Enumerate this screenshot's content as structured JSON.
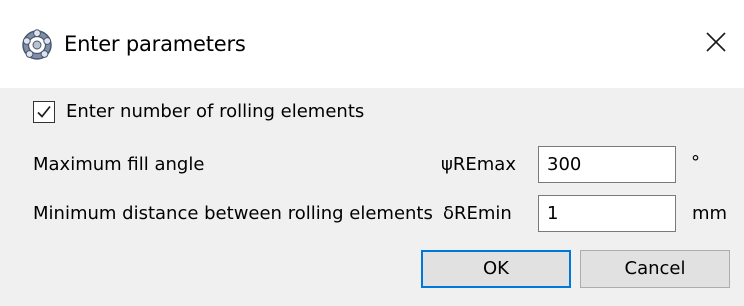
{
  "window": {
    "title": "Enter parameters",
    "app_icon": "rolling-bearing-icon",
    "close_icon": "close-icon"
  },
  "checkbox": {
    "label": "Enter number of rolling elements",
    "checked": true
  },
  "rows": [
    {
      "label": "Maximum fill angle",
      "symbol": "ψREmax",
      "value": "300",
      "unit": "°"
    },
    {
      "label": "Minimum distance between rolling elements",
      "symbol": "δREmin",
      "value": "1",
      "unit": "mm"
    }
  ],
  "buttons": {
    "ok": "OK",
    "cancel": "Cancel"
  },
  "colors": {
    "default_button_border": "#0078d7",
    "dialog_background": "#f0f0f0"
  }
}
